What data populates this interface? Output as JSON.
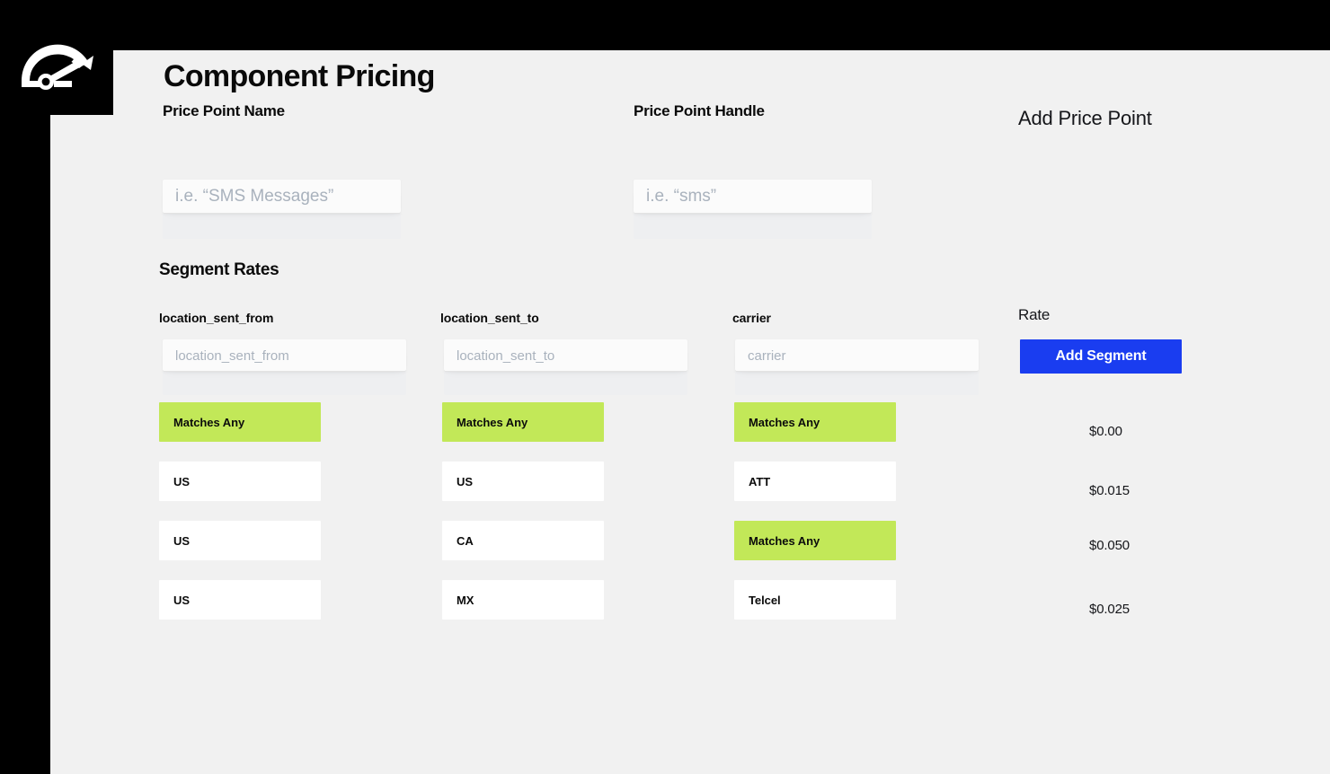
{
  "app": {
    "logo_icon": "speedometer-gauge-icon",
    "topbar_color": "#000000",
    "surface_color": "#f1f1f1",
    "accent_blue": "#1a3df0",
    "accent_green": "#c2e858"
  },
  "header": {
    "title": "Component Pricing",
    "add_price_point_label": "Add Price Point"
  },
  "price_point": {
    "name": {
      "label": "Price Point Name",
      "value": "",
      "placeholder": "i.e. “SMS Messages”"
    },
    "handle": {
      "label": "Price Point Handle",
      "value": "",
      "placeholder": "i.e. “sms”"
    }
  },
  "segment_rates": {
    "section_title": "Segment Rates",
    "add_segment_label": "Add Segment",
    "rate_column_label": "Rate",
    "columns": [
      {
        "label": "location_sent_from",
        "placeholder": "location_sent_from",
        "value": ""
      },
      {
        "label": "location_sent_to",
        "placeholder": "location_sent_to",
        "value": ""
      },
      {
        "label": "carrier",
        "placeholder": "carrier",
        "value": ""
      }
    ],
    "rows": [
      {
        "cells": [
          {
            "text": "Matches Any",
            "matched": true
          },
          {
            "text": "Matches Any",
            "matched": true
          },
          {
            "text": "Matches Any",
            "matched": true
          }
        ],
        "rate": "$0.00"
      },
      {
        "cells": [
          {
            "text": "US",
            "matched": false
          },
          {
            "text": "US",
            "matched": false
          },
          {
            "text": "ATT",
            "matched": false
          }
        ],
        "rate": "$0.015"
      },
      {
        "cells": [
          {
            "text": "US",
            "matched": false
          },
          {
            "text": "CA",
            "matched": false
          },
          {
            "text": "Matches Any",
            "matched": true
          }
        ],
        "rate": "$0.050"
      },
      {
        "cells": [
          {
            "text": "US",
            "matched": false
          },
          {
            "text": "MX",
            "matched": false
          },
          {
            "text": "Telcel",
            "matched": false
          }
        ],
        "rate": "$0.025"
      }
    ]
  }
}
